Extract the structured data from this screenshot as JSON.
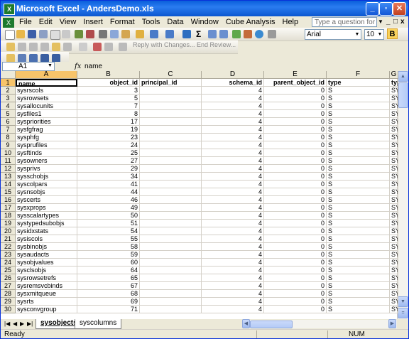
{
  "window": {
    "title": "Microsoft Excel - AndersDemo.xls",
    "app_icon": "X"
  },
  "menu": {
    "items": [
      "File",
      "Edit",
      "View",
      "Insert",
      "Format",
      "Tools",
      "Data",
      "Window",
      "Cube Analysis",
      "Help"
    ],
    "help_box_placeholder": "Type a question for help"
  },
  "toolbar": {
    "font_name": "Arial",
    "font_size": "10",
    "bold_label": "B",
    "review_text": "Reply with Changes...  End Review..."
  },
  "formula_bar": {
    "name_box": "A1",
    "fx": "fx",
    "content": "name"
  },
  "grid": {
    "columns": [
      "A",
      "B",
      "C",
      "D",
      "E",
      "F",
      "G"
    ],
    "header_row": [
      "name",
      "object_id",
      "principal_id",
      "schema_id",
      "parent_object_id",
      "type",
      "typ"
    ],
    "rows": [
      [
        "sysrscols",
        "3",
        "",
        "4",
        "0",
        "S",
        "SY"
      ],
      [
        "sysrowsets",
        "5",
        "",
        "4",
        "0",
        "S",
        "SY"
      ],
      [
        "sysallocunits",
        "7",
        "",
        "4",
        "0",
        "S",
        "SY"
      ],
      [
        "sysfiles1",
        "8",
        "",
        "4",
        "0",
        "S",
        "SY"
      ],
      [
        "syspriorities",
        "17",
        "",
        "4",
        "0",
        "S",
        "SY"
      ],
      [
        "sysfgfrag",
        "19",
        "",
        "4",
        "0",
        "S",
        "SY"
      ],
      [
        "sysphfg",
        "23",
        "",
        "4",
        "0",
        "S",
        "SY"
      ],
      [
        "sysprufiles",
        "24",
        "",
        "4",
        "0",
        "S",
        "SY"
      ],
      [
        "sysftinds",
        "25",
        "",
        "4",
        "0",
        "S",
        "SY"
      ],
      [
        "sysowners",
        "27",
        "",
        "4",
        "0",
        "S",
        "SY"
      ],
      [
        "sysprivs",
        "29",
        "",
        "4",
        "0",
        "S",
        "SY"
      ],
      [
        "sysschobjs",
        "34",
        "",
        "4",
        "0",
        "S",
        "SY"
      ],
      [
        "syscolpars",
        "41",
        "",
        "4",
        "0",
        "S",
        "SY"
      ],
      [
        "sysnsobjs",
        "44",
        "",
        "4",
        "0",
        "S",
        "SY"
      ],
      [
        "syscerts",
        "46",
        "",
        "4",
        "0",
        "S",
        "SY"
      ],
      [
        "sysxprops",
        "49",
        "",
        "4",
        "0",
        "S",
        "SY"
      ],
      [
        "sysscalartypes",
        "50",
        "",
        "4",
        "0",
        "S",
        "SY"
      ],
      [
        "systypedsubobjs",
        "51",
        "",
        "4",
        "0",
        "S",
        "SY"
      ],
      [
        "sysidxstats",
        "54",
        "",
        "4",
        "0",
        "S",
        "SY"
      ],
      [
        "sysiscols",
        "55",
        "",
        "4",
        "0",
        "S",
        "SY"
      ],
      [
        "sysbinobjs",
        "58",
        "",
        "4",
        "0",
        "S",
        "SY"
      ],
      [
        "sysaudacts",
        "59",
        "",
        "4",
        "0",
        "S",
        "SY"
      ],
      [
        "sysobjvalues",
        "60",
        "",
        "4",
        "0",
        "S",
        "SY"
      ],
      [
        "sysclsobjs",
        "64",
        "",
        "4",
        "0",
        "S",
        "SY"
      ],
      [
        "sysrowsetrefs",
        "65",
        "",
        "4",
        "0",
        "S",
        "SY"
      ],
      [
        "sysremsvcbinds",
        "67",
        "",
        "4",
        "0",
        "S",
        "SY"
      ],
      [
        "sysxmitqueue",
        "68",
        "",
        "4",
        "0",
        "S",
        "SY"
      ],
      [
        "sysrts",
        "69",
        "",
        "4",
        "0",
        "S",
        "SY"
      ],
      [
        "sysconvgroup",
        "71",
        "",
        "4",
        "0",
        "S",
        "SY"
      ]
    ]
  },
  "sheets": {
    "tabs": [
      "sysobjects",
      "syscolumns"
    ],
    "active": "sysobjects"
  },
  "status": {
    "left": "Ready",
    "num": "NUM"
  }
}
